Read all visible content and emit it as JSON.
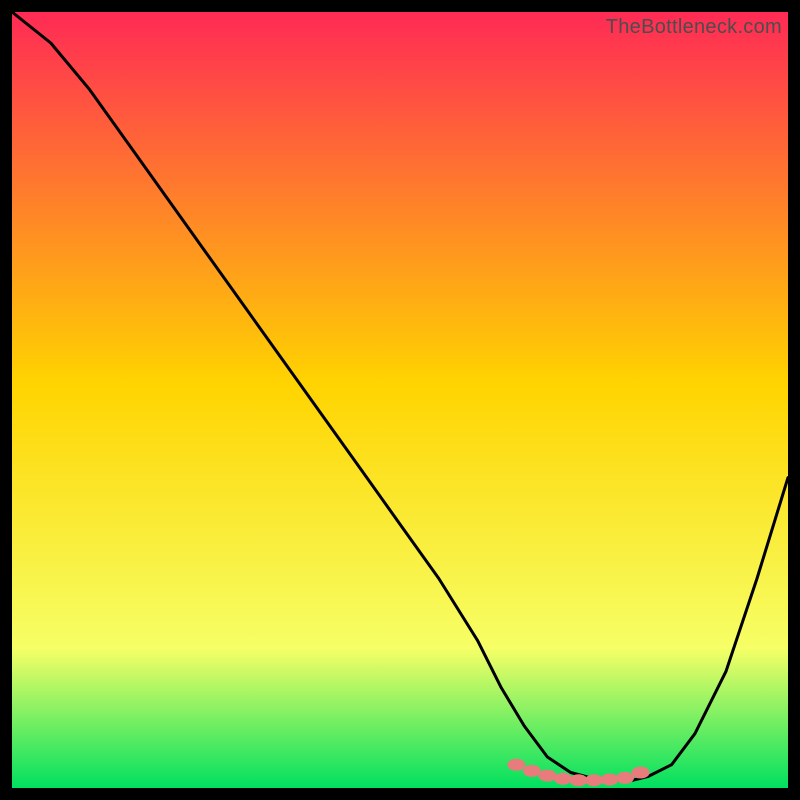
{
  "watermark": "TheBottleneck.com",
  "colors": {
    "gradient_top": "#ff2a55",
    "gradient_mid": "#ffd400",
    "gradient_low": "#f6ff66",
    "gradient_bottom": "#00e060",
    "background": "#000000",
    "curve": "#000000",
    "marker": "#e87b7b"
  },
  "chart_data": {
    "type": "line",
    "title": "",
    "xlabel": "",
    "ylabel": "",
    "xlim": [
      0,
      100
    ],
    "ylim": [
      0,
      100
    ],
    "grid": false,
    "legend": false,
    "series": [
      {
        "name": "bottleneck-curve",
        "x": [
          0,
          5,
          10,
          15,
          20,
          25,
          30,
          35,
          40,
          45,
          50,
          55,
          60,
          63,
          66,
          69,
          72,
          75,
          78,
          80,
          82,
          85,
          88,
          92,
          96,
          100
        ],
        "y": [
          100,
          96,
          90,
          83,
          76,
          69,
          62,
          55,
          48,
          41,
          34,
          27,
          19,
          13,
          8,
          4,
          2,
          1.2,
          1,
          1,
          1.5,
          3,
          7,
          15,
          27,
          40
        ]
      }
    ],
    "markers": {
      "name": "plateau-markers",
      "x": [
        65,
        67,
        69,
        71,
        73,
        75,
        77,
        79,
        81
      ],
      "y": [
        3.0,
        2.2,
        1.6,
        1.2,
        1.0,
        1.0,
        1.1,
        1.3,
        2.0
      ]
    }
  }
}
